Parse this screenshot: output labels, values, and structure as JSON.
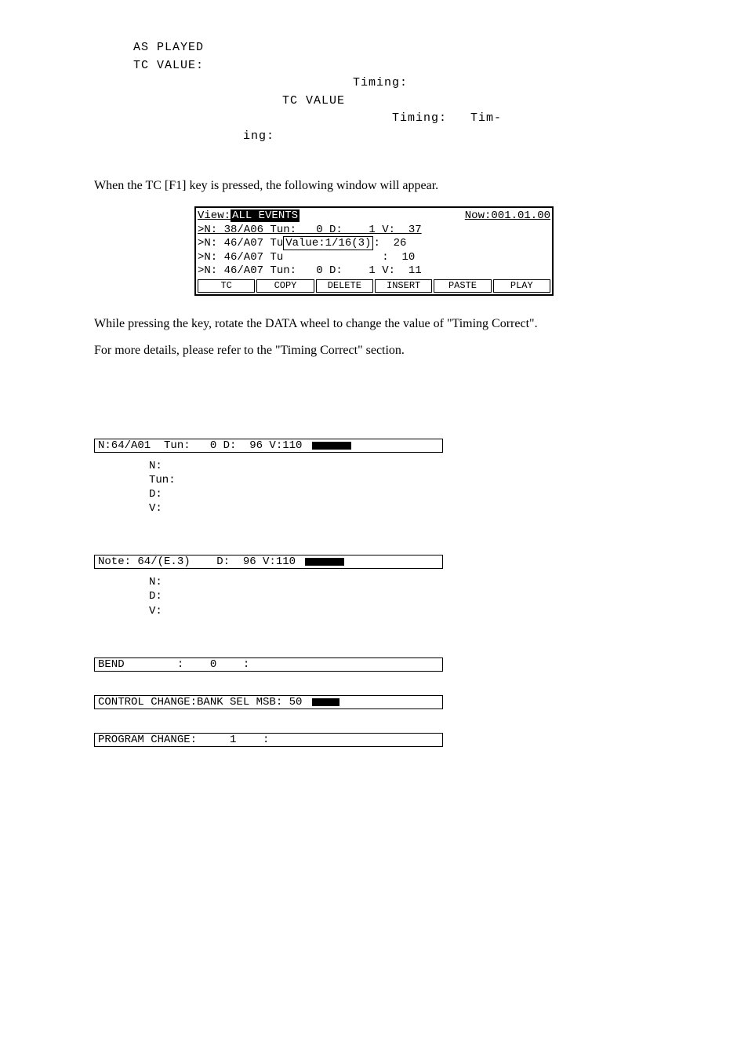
{
  "top": {
    "l1": "AS PLAYED",
    "l2": "TC VALUE:",
    "l3": "Timing:",
    "l4": "TC VALUE",
    "l5": "Timing:",
    "l6": "Tim-",
    "l7": "ing:"
  },
  "para1": "When the TC [F1] key is pressed, the following window will appear.",
  "window": {
    "view_label": "View:",
    "view_value": "ALL EVENTS",
    "now_label": "Now:001.01.00",
    "lines": {
      "r1": ">N: 38/A06 Tun:   0 D:    1 V:  37",
      "r2a": ">N: 46/A07 Tu",
      "r2b": "Value:1/16(3)",
      "r2c": ":  26",
      "r3": ">N: 46/A07 Tu               :  10",
      "r4": ">N: 46/A07 Tun:   0 D:    1 V:  11"
    },
    "softkeys": [
      "TC",
      "COPY",
      "DELETE",
      "INSERT",
      "PASTE",
      "PLAY"
    ]
  },
  "para2": "While pressing the key, rotate the DATA wheel to change the value of \"Timing Correct\".",
  "para3": "For more details, please refer to the \"Timing Correct\" section.",
  "evt1": {
    "line": "N:64/A01  Tun:   0 D:  96 V:110 ",
    "fields": [
      "N:",
      "Tun:",
      "D:",
      "V:"
    ]
  },
  "evt2": {
    "line": "Note: 64/(E.3)    D:  96 V:110 ",
    "fields": [
      "N:",
      "D:",
      "V:"
    ]
  },
  "evt3": {
    "line": "BEND        :    0    :"
  },
  "evt4": {
    "line": "CONTROL CHANGE:BANK SEL MSB: 50 "
  },
  "evt5": {
    "line": "PROGRAM CHANGE:     1    :"
  }
}
